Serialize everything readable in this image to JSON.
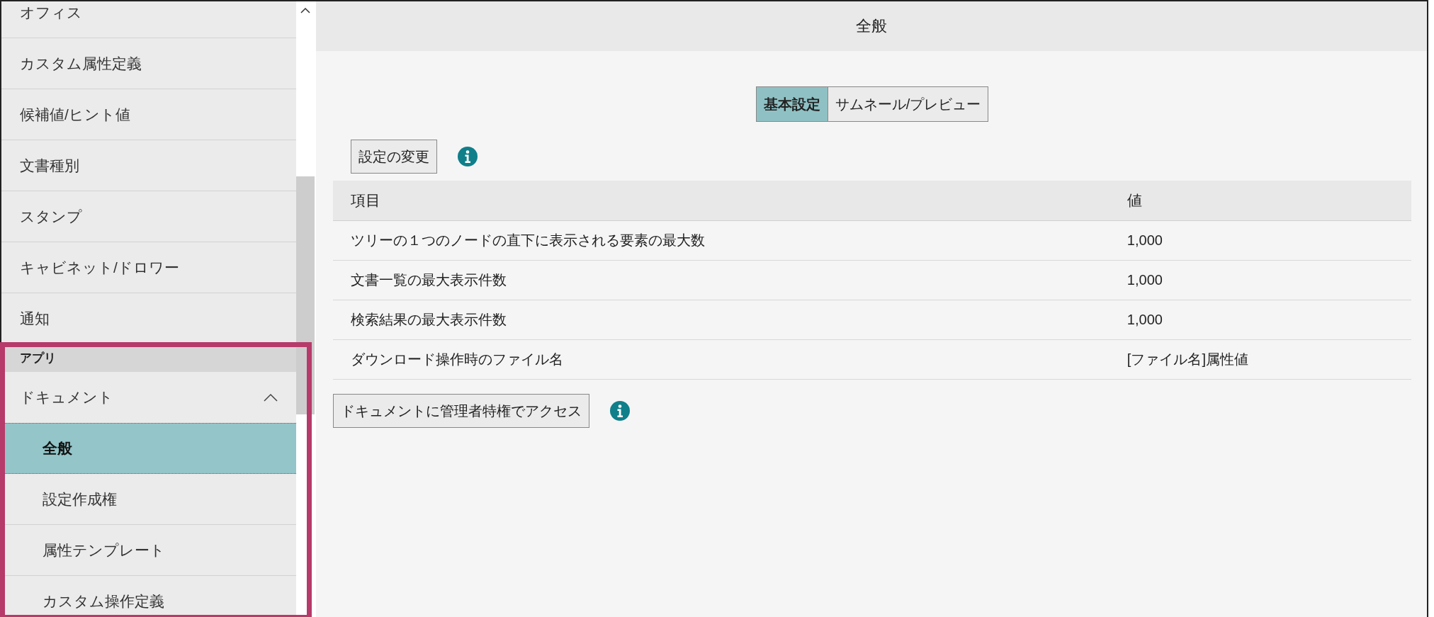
{
  "sidebar": {
    "items": [
      {
        "label": "オフィス",
        "selected": false
      },
      {
        "label": "カスタム属性定義",
        "selected": false
      },
      {
        "label": "候補値/ヒント値",
        "selected": false
      },
      {
        "label": "文書種別",
        "selected": false
      },
      {
        "label": "スタンプ",
        "selected": false
      },
      {
        "label": "キャビネット/ドロワー",
        "selected": false
      },
      {
        "label": "通知",
        "selected": false
      }
    ],
    "section": {
      "title": "アプリ",
      "group": {
        "label": "ドキュメント",
        "expanded": true,
        "children": [
          {
            "label": "全般",
            "selected": true
          },
          {
            "label": "設定作成権",
            "selected": false
          },
          {
            "label": "属性テンプレート",
            "selected": false
          },
          {
            "label": "カスタム操作定義",
            "selected": false
          }
        ]
      }
    }
  },
  "main": {
    "title": "全般",
    "tabs": [
      {
        "label": "基本設定",
        "selected": true
      },
      {
        "label": "サムネール/プレビュー",
        "selected": false
      }
    ],
    "change_button": "設定の変更",
    "table": {
      "columns": [
        "項目",
        "値"
      ],
      "rows": [
        [
          "ツリーの１つのノードの直下に表示される要素の最大数",
          "1,000"
        ],
        [
          "文書一覧の最大表示件数",
          "1,000"
        ],
        [
          "検索結果の最大表示件数",
          "1,000"
        ],
        [
          "ダウンロード操作時のファイル名",
          "[ファイル名]属性値"
        ]
      ]
    },
    "admin_button": "ドキュメントに管理者特権でアクセス"
  }
}
